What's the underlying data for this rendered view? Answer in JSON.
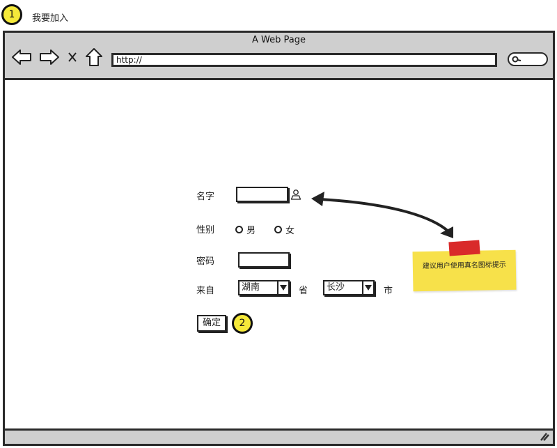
{
  "annotations": {
    "badge1": "1",
    "badge2": "2",
    "caption": "我要加入"
  },
  "window": {
    "title": "A Web Page",
    "url": "http://"
  },
  "icons": {
    "back": "arrow-left-icon",
    "forward": "arrow-right-icon",
    "stop": "close-icon",
    "home": "home-icon",
    "search": "search-icon",
    "user": "user-icon",
    "dropdown": "caret-down-icon",
    "resize": "resize-grip-icon"
  },
  "form": {
    "name_label": "名字",
    "gender_label": "性别",
    "gender_options": [
      "男",
      "女"
    ],
    "password_label": "密码",
    "origin_label": "来自",
    "province_value": "湖南",
    "province_suffix": "省",
    "city_value": "长沙",
    "city_suffix": "市",
    "submit_label": "确定"
  },
  "note": {
    "text": "建议用户使用真名图标提示"
  },
  "colors": {
    "chrome": "#cfcfcf",
    "badge": "#f5e93a",
    "sticky": "#f7e14a",
    "tape": "#d92a2a",
    "stroke": "#222222"
  }
}
